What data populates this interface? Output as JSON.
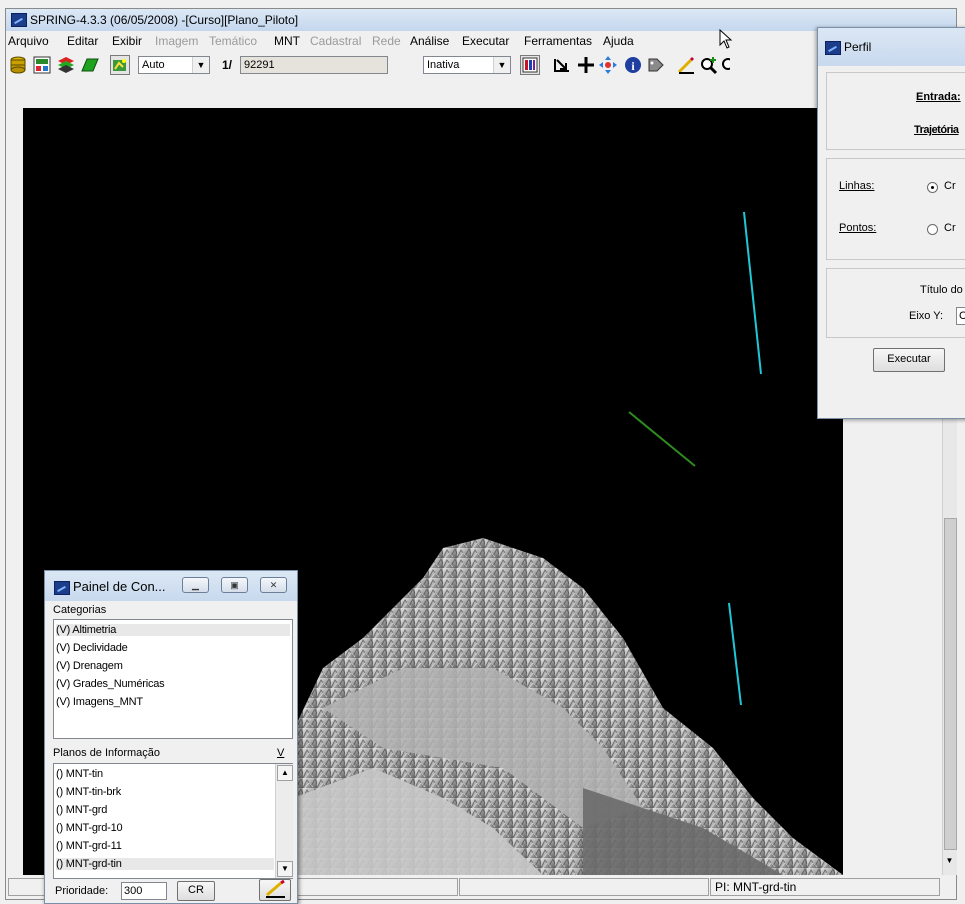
{
  "window": {
    "title": "SPRING-4.3.3 (06/05/2008) -[Curso][Plano_Piloto]"
  },
  "menu": [
    {
      "label": "Arquivo",
      "enabled": true
    },
    {
      "label": "Editar",
      "enabled": true
    },
    {
      "label": "Exibir",
      "enabled": true
    },
    {
      "label": "Imagem",
      "enabled": false
    },
    {
      "label": "Temático",
      "enabled": false
    },
    {
      "label": "MNT",
      "enabled": true
    },
    {
      "label": "Cadastral",
      "enabled": false
    },
    {
      "label": "Rede",
      "enabled": false
    },
    {
      "label": "Análise",
      "enabled": true
    },
    {
      "label": "Executar",
      "enabled": true
    },
    {
      "label": "Ferramentas",
      "enabled": true
    },
    {
      "label": "Ajuda",
      "enabled": true
    }
  ],
  "toolbar": {
    "zoom_mode": "Auto",
    "scale_prefix": "1/",
    "scale_value": "92291",
    "mode_select": "Inativa"
  },
  "panel": {
    "title": "Painel de Con...",
    "categories_label": "Categorias",
    "categories": [
      "(V) Altimetria",
      "(V) Declividade",
      "(V) Drenagem",
      "(V) Grades_Numéricas",
      "(V) Imagens_MNT"
    ],
    "planes_label": "Planos de Informação",
    "planes_col": "V",
    "planes": [
      "() MNT-tin",
      "() MNT-tin-brk",
      "() MNT-grd",
      "() MNT-grd-10",
      "() MNT-grd-11",
      "() MNT-grd-tin"
    ],
    "priority_label": "Prioridade:",
    "priority_value": "300",
    "cr_label": "CR"
  },
  "perfil": {
    "title": "Perfil",
    "entrada_label": "Entrada:",
    "trajetoria_label": "Trajetória",
    "linhas_label": "Linhas:",
    "linhas_option": "Cr",
    "pontos_label": "Pontos:",
    "pontos_option": "Cr",
    "titulo_label": "Título do",
    "eixo_label": "Eixo Y:",
    "eixo_value": "C",
    "executar_label": "Executar"
  },
  "status": {
    "pi": "PI: MNT-grd-tin"
  },
  "colors": {
    "canvas_bg": "#000000",
    "profile_line_cyan": "#21c6d6",
    "profile_line_green": "#2e8b1e"
  }
}
